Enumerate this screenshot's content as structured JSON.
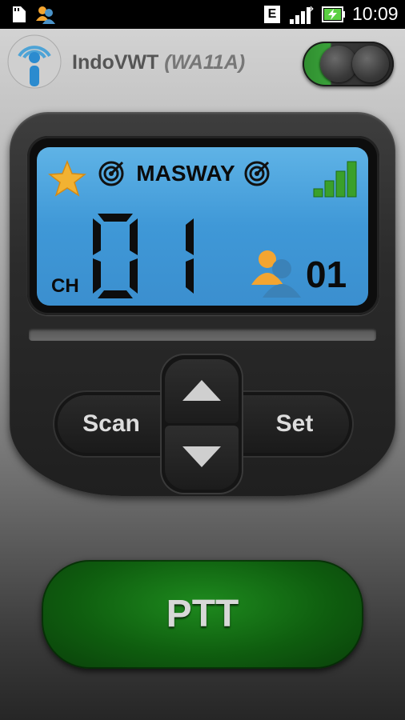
{
  "status_bar": {
    "time": "10:09",
    "network_badge": "E",
    "icons": [
      "sd-card-icon",
      "people-icon",
      "signal-icon",
      "battery-charging-icon"
    ]
  },
  "header": {
    "app_name": "IndoVWT",
    "callsign": "(WA11A)",
    "logo_icon": "info-broadcast-icon",
    "power_toggle_state": "on"
  },
  "lcd": {
    "channel_name": "MASWAY",
    "channel_label": "CH",
    "channel_number": "01",
    "user_count": "01",
    "favorite_icon": "star-icon",
    "signal_strength_bars": 4
  },
  "controls": {
    "scan_label": "Scan",
    "set_label": "Set",
    "ptt_label": "PTT"
  },
  "colors": {
    "lcd_blue": "#4aa3dd",
    "ptt_green": "#0f5e0f",
    "toggle_green": "#3aa23a",
    "signal_green": "#3aa02a"
  }
}
